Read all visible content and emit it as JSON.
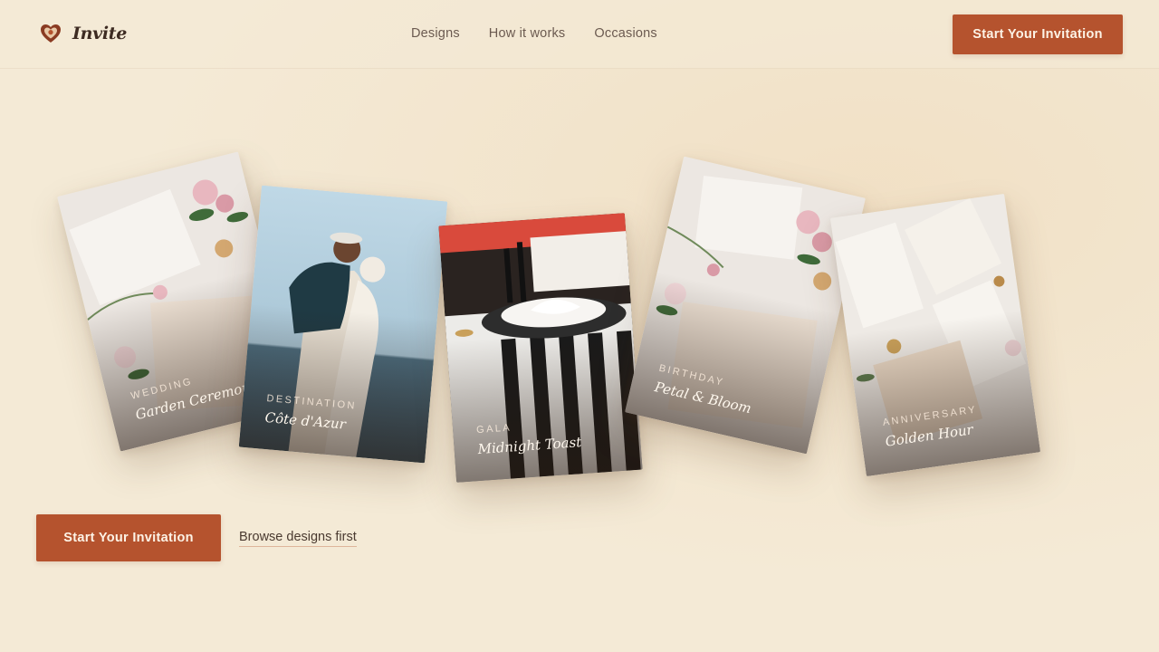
{
  "brand": {
    "name": "Invite",
    "icon": "heart-seal-icon",
    "accent": "#b5532e"
  },
  "nav": {
    "items": [
      "Designs",
      "How it works",
      "Occasions"
    ]
  },
  "header_cta": {
    "label": "Start Your Invitation"
  },
  "cards": [
    {
      "category": "WEDDING",
      "title": "Garden Ceremony"
    },
    {
      "category": "DESTINATION",
      "title": "Côte d'Azur"
    },
    {
      "category": "GALA",
      "title": "Midnight Toast"
    },
    {
      "category": "BIRTHDAY",
      "title": "Petal & Bloom"
    },
    {
      "category": "ANNIVERSARY",
      "title": "Golden Hour"
    }
  ],
  "hero": {
    "cta_label": "Start Your Invitation",
    "secondary_label": "Browse designs first"
  },
  "colors": {
    "background": "#f4ead6",
    "accent": "#b5532e",
    "text": "#3a2a22"
  }
}
